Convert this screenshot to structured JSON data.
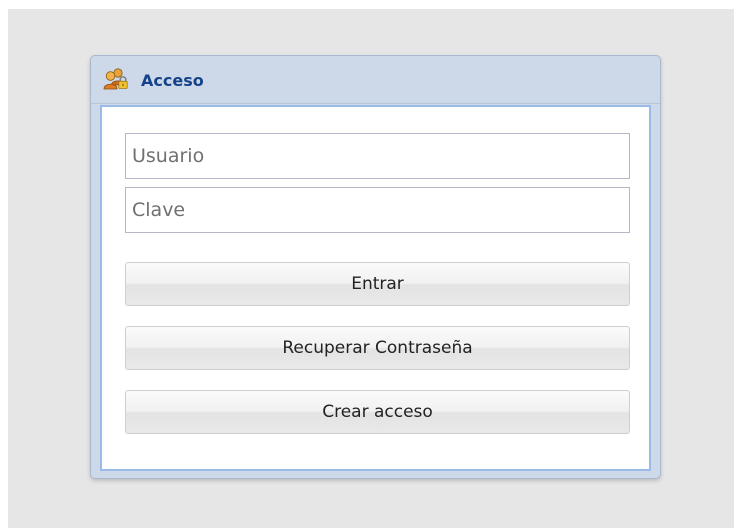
{
  "panel": {
    "title": "Acceso",
    "icon": "users-lock-icon"
  },
  "form": {
    "username_placeholder": "Usuario",
    "password_placeholder": "Clave",
    "username_value": "",
    "password_value": ""
  },
  "buttons": {
    "login_label": "Entrar",
    "recover_label": "Recuperar Contraseña",
    "create_label": "Crear acceso"
  },
  "colors": {
    "page_background": "#e6e6e6",
    "panel_header": "#cdd9e8",
    "panel_body_border": "#99bbe8",
    "title_text": "#15428b"
  }
}
